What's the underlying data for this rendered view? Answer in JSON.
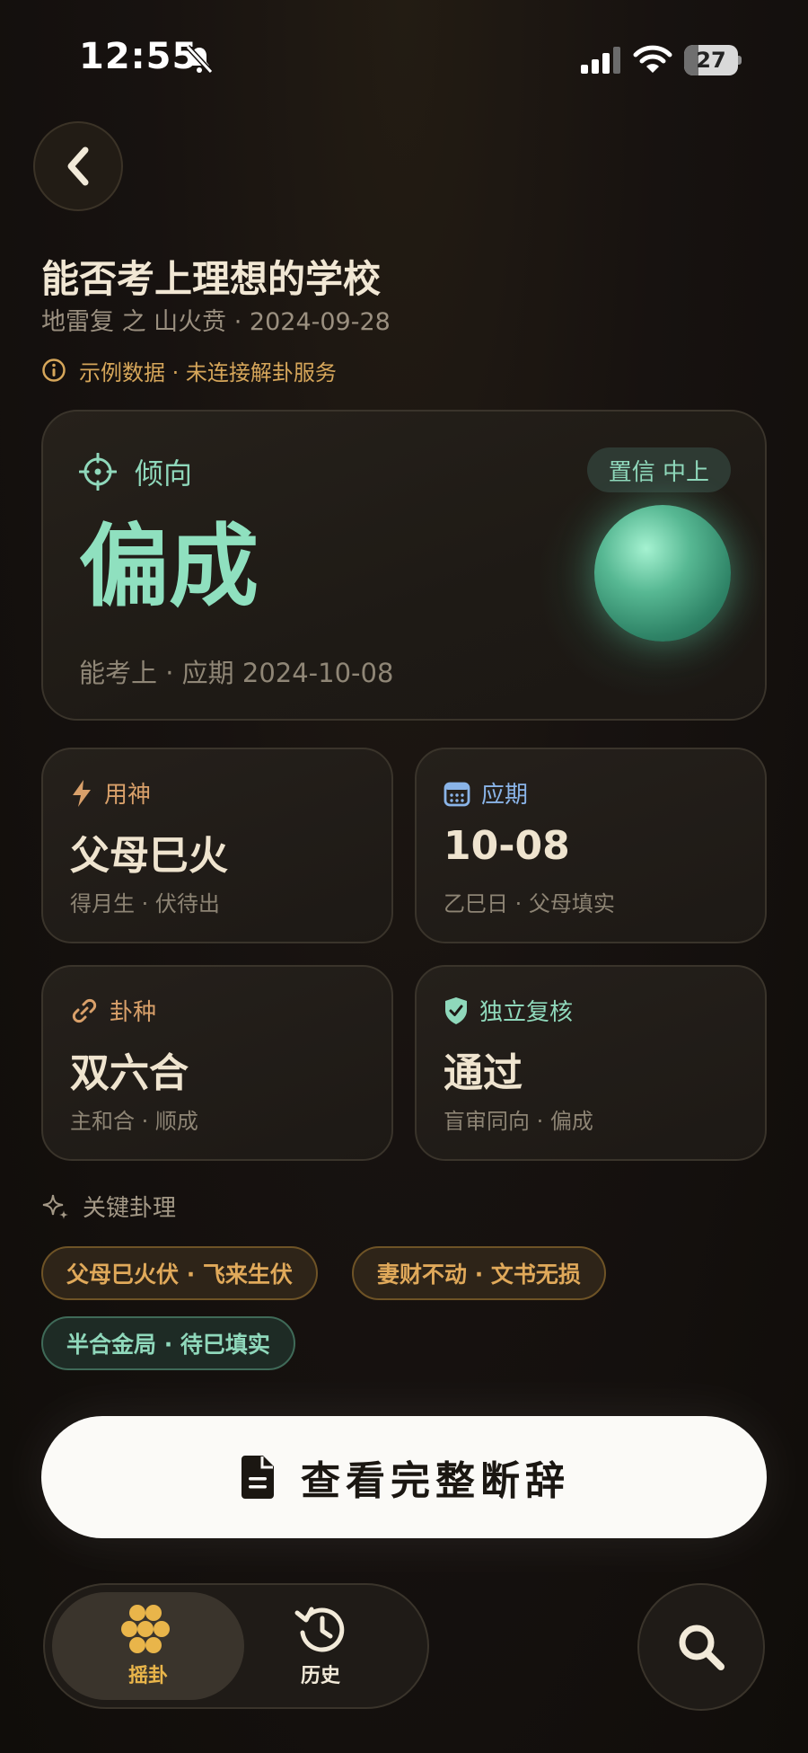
{
  "status_bar": {
    "time": "12:55",
    "battery": "27",
    "battery_level": 0.27
  },
  "header": {
    "title": "能否考上理想的学校",
    "subtitle": "地雷复 之 山火贲 · 2024-09-28",
    "notice": "示例数据 · 未连接解卦服务"
  },
  "verdict_card": {
    "label": "倾向",
    "confidence": "置信 中上",
    "verdict": "偏成",
    "note": "能考上 · 应期 2024-10-08"
  },
  "cards": [
    {
      "label": "用神",
      "value": "父母巳火",
      "note": "得月生 · 伏待出",
      "icon": "lightning-icon",
      "color": "#d9a06a"
    },
    {
      "label": "应期",
      "value": "10-08",
      "note": "乙巳日 · 父母填实",
      "icon": "calendar-icon",
      "color": "#8ab4e8"
    },
    {
      "label": "卦种",
      "value": "双六合",
      "note": "主和合 · 顺成",
      "icon": "link-icon",
      "color": "#d9a06a"
    },
    {
      "label": "独立复核",
      "value": "通过",
      "note": "盲审同向 · 偏成",
      "icon": "shield-check-icon",
      "color": "#8fd8bb"
    }
  ],
  "key_points": {
    "label": "关键卦理",
    "chips": [
      {
        "text": "父母巳火伏 · 飞来生伏",
        "tone": "amber"
      },
      {
        "text": "妻财不动 · 文书无损",
        "tone": "amber"
      },
      {
        "text": "半合金局 · 待巳填实",
        "tone": "green"
      }
    ]
  },
  "primary_action": {
    "label": "查看完整断辞"
  },
  "tabs": [
    {
      "label": "摇卦",
      "icon": "coins-icon",
      "active": true
    },
    {
      "label": "历史",
      "icon": "history-icon",
      "active": false
    }
  ],
  "colors": {
    "accent_green": "#8fe0bf",
    "accent_amber": "#e0a95a",
    "background": "#171210"
  }
}
